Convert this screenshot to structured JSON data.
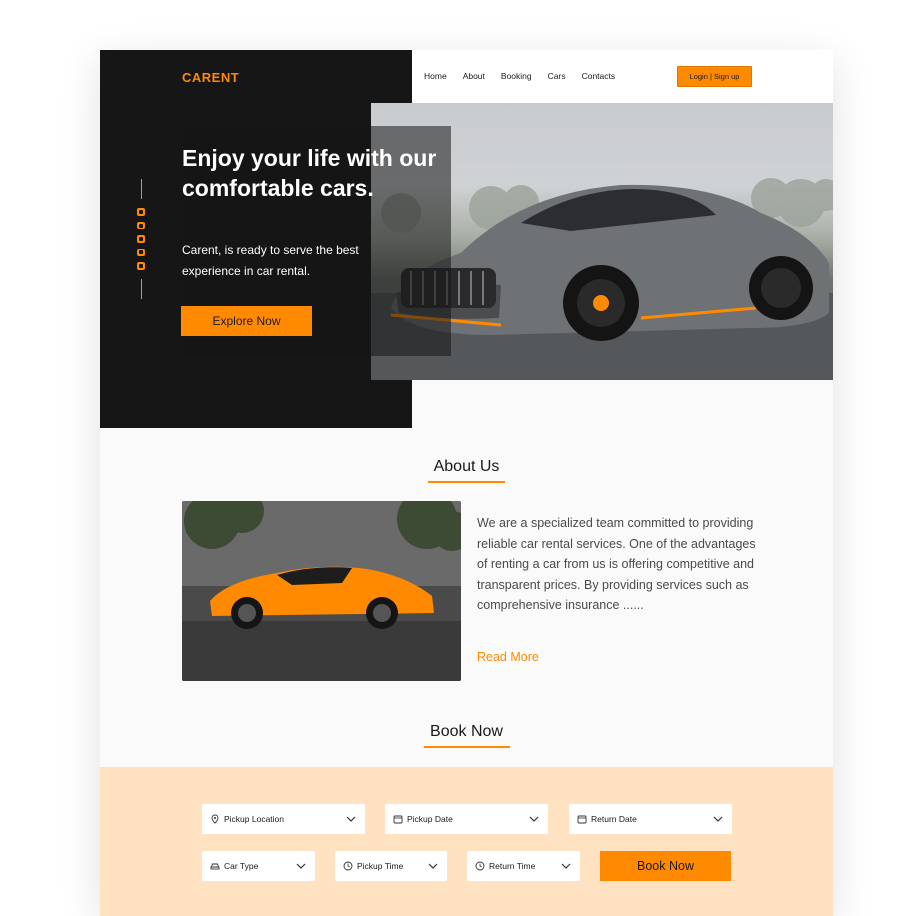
{
  "brand": "CARENT",
  "nav": {
    "links": [
      "Home",
      "About",
      "Booking",
      "Cars",
      "Contacts"
    ],
    "login_label": "Login | Sign up"
  },
  "hero": {
    "title": "Enjoy your life with our comfortable cars.",
    "subtitle": "Carent, is ready to serve the best experience in car rental.",
    "cta_label": "Explore Now",
    "social_icons": [
      "facebook-icon",
      "instagram-icon",
      "twitter-icon",
      "pinterest-icon",
      "telegram-icon"
    ]
  },
  "about": {
    "title": "About Us",
    "body": "We are a specialized team committed to providing reliable car rental services. One of the advantages of renting a car from us is offering competitive and transparent prices. By providing services such as comprehensive insurance ......",
    "read_more": "Read More"
  },
  "booking": {
    "title": "Book Now",
    "fields": {
      "pickup_location": "Pickup Location",
      "pickup_date": "Pickup Date",
      "return_date": "Return Date",
      "car_type": "Car Type",
      "pickup_time": "Pickup Time",
      "return_time": "Return Time"
    },
    "submit_label": "Book Now"
  },
  "colors": {
    "accent": "#ff8a00",
    "dark": "#161616",
    "booking_bg": "#ffe2c1"
  }
}
